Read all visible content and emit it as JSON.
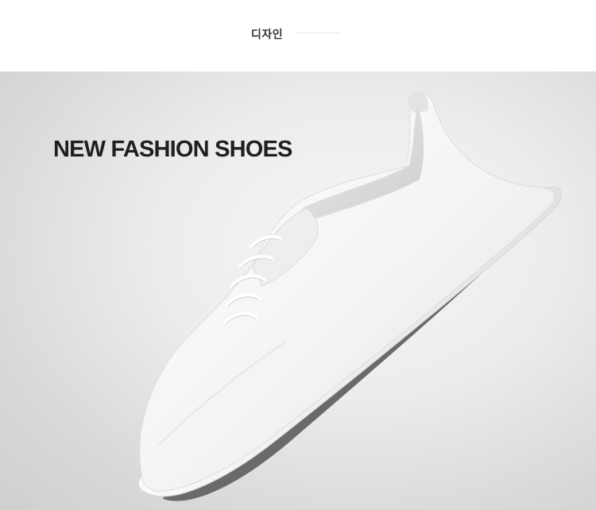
{
  "section": {
    "title": "디자인"
  },
  "hero": {
    "headline": "NEW FASHION SHOES",
    "image": "white leather lace-up low sneaker floating on grey backdrop"
  },
  "colors": {
    "background_top": "#ffffff",
    "backdrop": "#dcdcdc",
    "headline": "#1f1f1f",
    "shoe_body": "#f7f7f7"
  }
}
